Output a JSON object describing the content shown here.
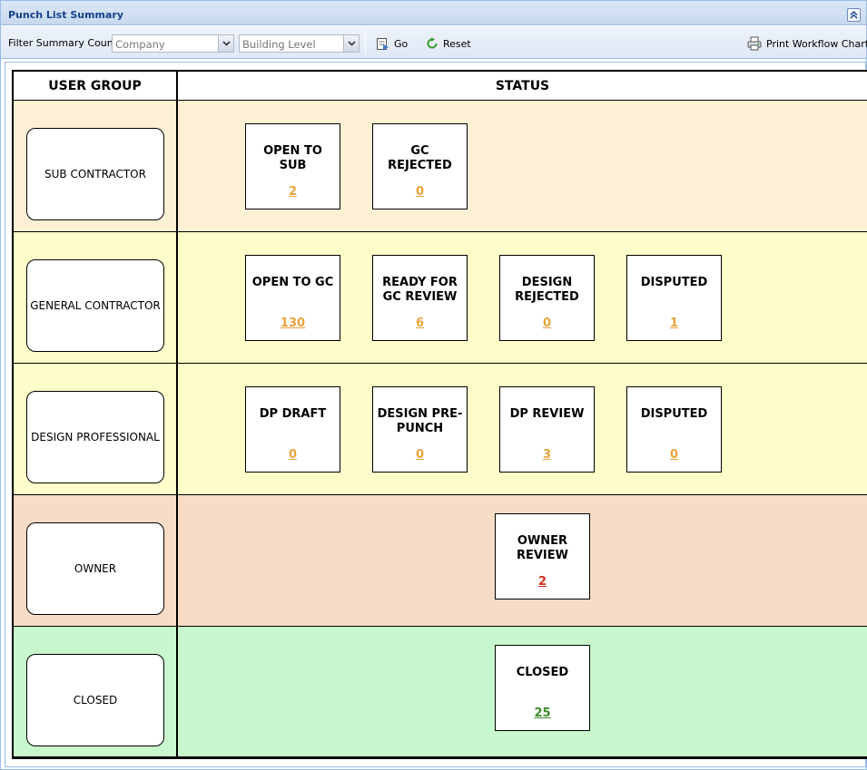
{
  "panel": {
    "title": "Punch List Summary"
  },
  "toolbar": {
    "filter_label": "Filter Summary Count:",
    "company_placeholder": "Company",
    "building_placeholder": "Building Level",
    "go_label": "Go",
    "reset_label": "Reset",
    "print_label": "Print Workflow Chart"
  },
  "grid": {
    "col_user_group": "USER GROUP",
    "col_status": "STATUS",
    "rows": [
      {
        "group": "SUB CONTRACTOR",
        "bg": "#fdf0d5",
        "cards": [
          {
            "title": "OPEN TO SUB",
            "count": "2"
          },
          {
            "title": "GC REJECTED",
            "count": "0"
          }
        ]
      },
      {
        "group": "GENERAL CONTRACTOR",
        "bg": "#fdfdc9",
        "cards": [
          {
            "title": "OPEN TO GC",
            "count": "130"
          },
          {
            "title": "READY FOR GC REVIEW",
            "count": "6"
          },
          {
            "title": "DESIGN REJECTED",
            "count": "0"
          },
          {
            "title": "DISPUTED",
            "count": "1"
          }
        ]
      },
      {
        "group": "DESIGN PROFESSIONAL",
        "bg": "#fdfdc9",
        "cards": [
          {
            "title": "DP DRAFT",
            "count": "0"
          },
          {
            "title": "DESIGN PRE-PUNCH",
            "count": "0"
          },
          {
            "title": "DP REVIEW",
            "count": "3"
          },
          {
            "title": "DISPUTED",
            "count": "0"
          }
        ]
      },
      {
        "group": "OWNER",
        "bg": "#f7dcc6",
        "cards": [
          {
            "title": "OWNER REVIEW",
            "count": "2"
          }
        ]
      },
      {
        "group": "CLOSED",
        "bg": "#c9f7cd",
        "cards": [
          {
            "title": "CLOSED",
            "count": "25"
          }
        ]
      }
    ]
  },
  "colors": {
    "count_default": "#e8a33a",
    "count_owner": "#d03020",
    "count_closed": "#3d8a2a"
  }
}
